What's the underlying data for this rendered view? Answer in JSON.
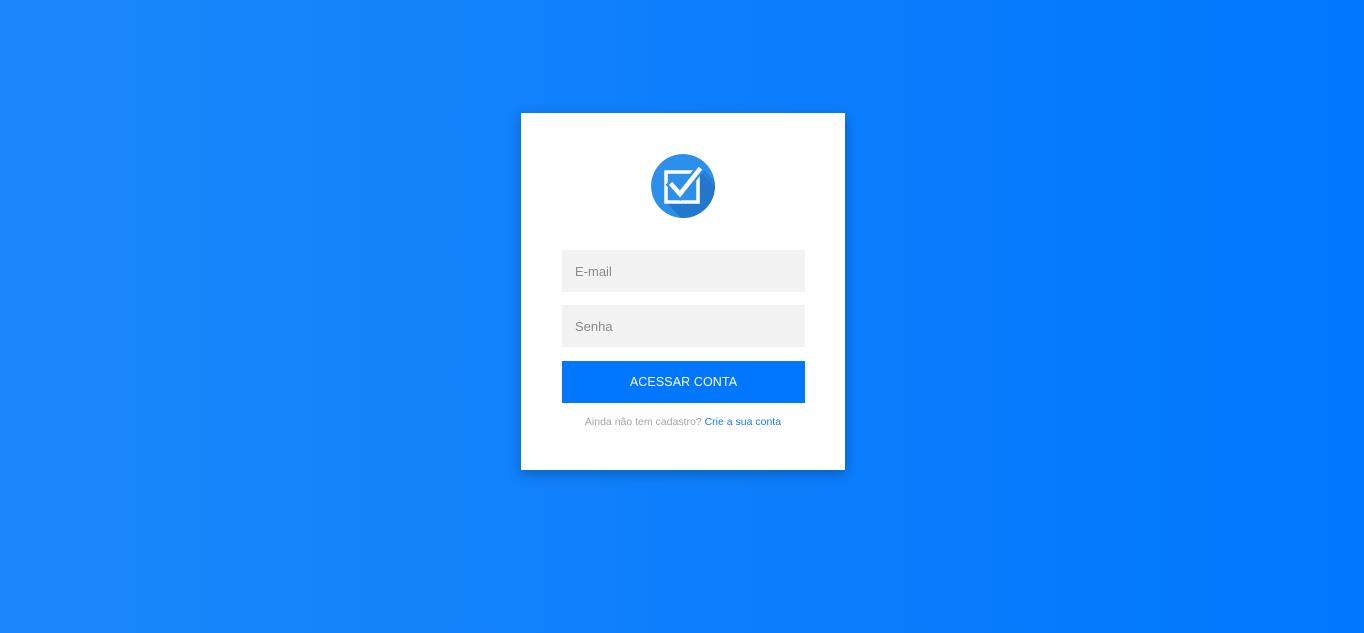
{
  "colors": {
    "background_start": "#1c87fa",
    "background_end": "#0077fe",
    "button": "#0077fe",
    "link": "#1479f2",
    "logo_circle": "#2d8fec"
  },
  "logo": {
    "icon": "checkbox-check-icon"
  },
  "form": {
    "email_placeholder": "E-mail",
    "password_placeholder": "Senha",
    "submit_label": "ACESSAR CONTA"
  },
  "signup": {
    "prompt": "Ainda não tem cadastro?",
    "link_label": "Crie a sua conta"
  }
}
